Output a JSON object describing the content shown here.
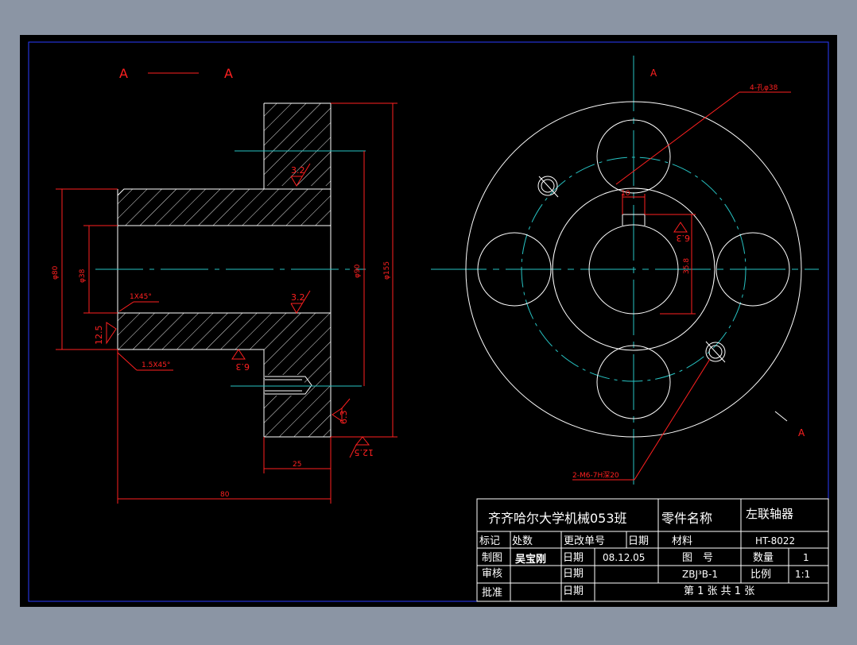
{
  "colors": {
    "paper": "#000000",
    "outline": "#ffffff",
    "dimension": "#ff2020",
    "center": "#27c4c4",
    "background": "#8b95a4"
  },
  "section": {
    "label_left": "A",
    "label_right": "A"
  },
  "view_marks": {
    "top": "A",
    "bottom": "A"
  },
  "roughness": {
    "r1": "3.2",
    "r2": "3.2",
    "r3": "12.5",
    "r4": "6.3",
    "r5": "6.3",
    "r6": "12.5",
    "r7": "6.3"
  },
  "dims": {
    "od_left": "φ80",
    "bore": "φ38",
    "pcd": "φ90",
    "outer": "φ155",
    "chamfer1": "1X45°",
    "chamfer2": "1.5X45°",
    "len_hub": "25",
    "len_total": "80",
    "holes": "4-孔φ38",
    "key_w": "10",
    "key_h": "35.8",
    "threads": "2-M6-7H深20"
  },
  "title_block": {
    "school": "齐齐哈尔大学机械053班",
    "part_label": "零件名称",
    "part_name": "左联轴器",
    "material": "HT-8022",
    "h_mark": "标记",
    "h_count": "处数",
    "h_change": "更改单号",
    "h_date": "日期",
    "h_material": "材料",
    "drawn_label": "制图",
    "drawn_by": "吴宝刚",
    "date_label1": "日期",
    "date_value": "08.12.05",
    "check_label": "审核",
    "date_label2": "日期",
    "approve_label": "批准",
    "date_label3": "日期",
    "drawing_no_label": "图　号",
    "drawing_no": "ZBJ³B-1",
    "qty_label": "数量",
    "qty": "1",
    "scale_label": "比例",
    "scale": "1:1",
    "sheet_info": "第 1 张  共 1 张"
  }
}
